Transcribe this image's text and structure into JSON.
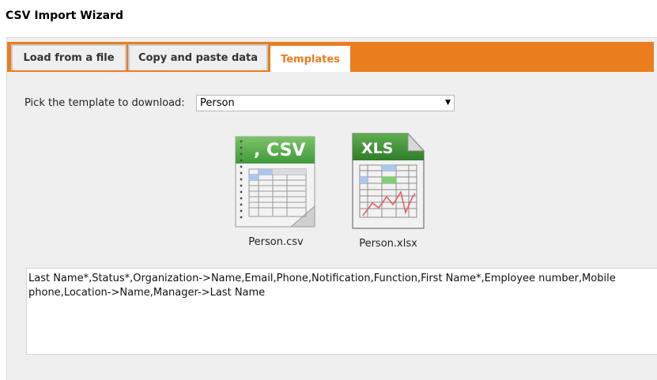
{
  "window": {
    "title": "CSV Import Wizard"
  },
  "tabs": [
    {
      "label": "Load from a file",
      "active": false
    },
    {
      "label": "Copy and paste data",
      "active": false
    },
    {
      "label": "Templates",
      "active": true
    }
  ],
  "template_picker": {
    "label": "Pick the template to download:",
    "selected": "Person"
  },
  "files": [
    {
      "name": "Person.csv",
      "icon": "csv-file-icon",
      "badge": ", CSV"
    },
    {
      "name": "Person.xlsx",
      "icon": "xls-file-icon",
      "badge": "XLS"
    }
  ],
  "preview": {
    "text": "Last Name*,Status*,Organization->Name,Email,Phone,Notification,Function,First Name*,Employee number,Mobile phone,Location->Name,Manager->Last Name"
  },
  "colors": {
    "accent": "#ea7d1e",
    "panel": "#efefef"
  }
}
